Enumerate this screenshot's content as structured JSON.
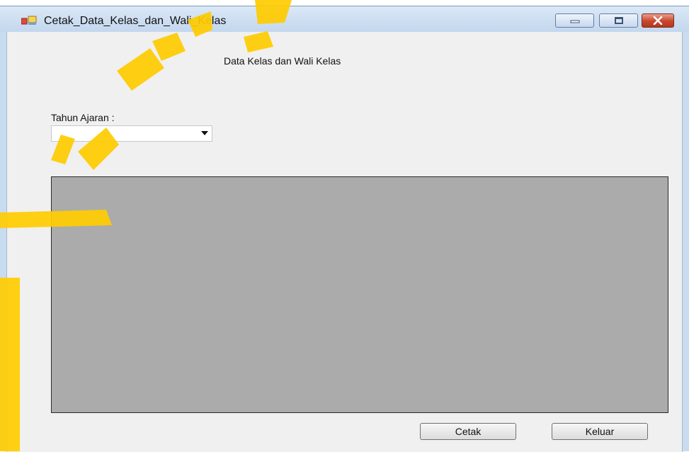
{
  "window": {
    "title": "Cetak_Data_Kelas_dan_Wali_Kelas",
    "controls": {
      "minimize": "minimize-icon",
      "maximize": "maximize-icon",
      "close": "close-icon"
    }
  },
  "form": {
    "heading": "Data Kelas dan Wali Kelas",
    "tahun_ajaran_label": "Tahun Ajaran :",
    "tahun_ajaran_value": ""
  },
  "buttons": {
    "cetak": "Cetak",
    "keluar": "Keluar"
  },
  "colors": {
    "form_background": "#f0f0f0",
    "report_viewer": "#ababab",
    "close_button": "#c9452b",
    "watermark": "#ffcc00"
  }
}
